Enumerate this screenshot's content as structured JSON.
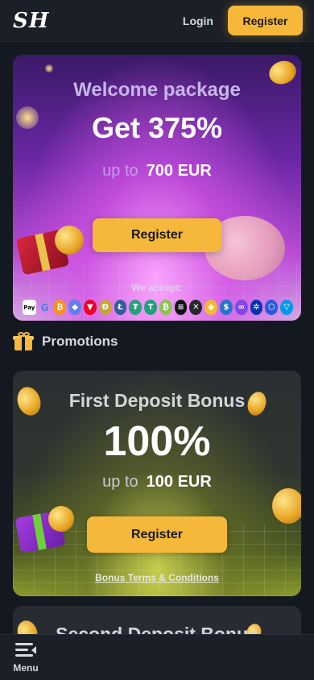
{
  "header": {
    "logo_text": "SH",
    "login_label": "Login",
    "register_label": "Register"
  },
  "welcome_card": {
    "title": "Welcome package",
    "headline": "Get 375%",
    "up_to_label": "up to",
    "amount": "700 EUR",
    "register_label": "Register",
    "accept_label": "We accept:",
    "payment_methods": [
      {
        "name": "apple-pay-icon",
        "glyph": "Pay",
        "color": "#ffffff"
      },
      {
        "name": "google-pay-icon",
        "glyph": "G",
        "color": "#4285f4"
      },
      {
        "name": "bitcoin-icon",
        "glyph": "₿",
        "color": "#f7931a"
      },
      {
        "name": "ethereum-icon",
        "glyph": "◆",
        "color": "#627eea"
      },
      {
        "name": "tron-icon",
        "glyph": "▼",
        "color": "#eb0029"
      },
      {
        "name": "dogecoin-icon",
        "glyph": "Đ",
        "color": "#c3a634"
      },
      {
        "name": "litecoin-icon",
        "glyph": "Ł",
        "color": "#345d9d"
      },
      {
        "name": "tether-icon",
        "glyph": "₮",
        "color": "#26a17b"
      },
      {
        "name": "tether-usdt-icon",
        "glyph": "T",
        "color": "#1ba27a"
      },
      {
        "name": "bitcoin-cash-icon",
        "glyph": "₿",
        "color": "#8dc351"
      },
      {
        "name": "solana-icon",
        "glyph": "≡",
        "color": "#111111"
      },
      {
        "name": "xrp-icon",
        "glyph": "✕",
        "color": "#23292f"
      },
      {
        "name": "binance-icon",
        "glyph": "◆",
        "color": "#f3ba2f"
      },
      {
        "name": "usdc-icon",
        "glyph": "$",
        "color": "#2775ca"
      },
      {
        "name": "polygon-icon",
        "glyph": "∞",
        "color": "#8247e5"
      },
      {
        "name": "cardano-icon",
        "glyph": "✲",
        "color": "#0033ad"
      },
      {
        "name": "chainlink-icon",
        "glyph": "⬡",
        "color": "#2a5ada"
      },
      {
        "name": "toncoin-icon",
        "glyph": "▽",
        "color": "#0098ea"
      }
    ]
  },
  "promotions": {
    "title": "Promotions"
  },
  "first_deposit_card": {
    "title": "First Deposit Bonus",
    "headline": "100%",
    "up_to_label": "up to",
    "amount": "100 EUR",
    "register_label": "Register",
    "terms_label": "Bonus Terms & Conditions"
  },
  "second_deposit_card": {
    "title": "Second Deposit Bonus"
  },
  "bottom_nav": {
    "menu_label": "Menu"
  },
  "colors": {
    "accent": "#f5b83b",
    "background": "#141820",
    "surface": "#1b1f27"
  }
}
